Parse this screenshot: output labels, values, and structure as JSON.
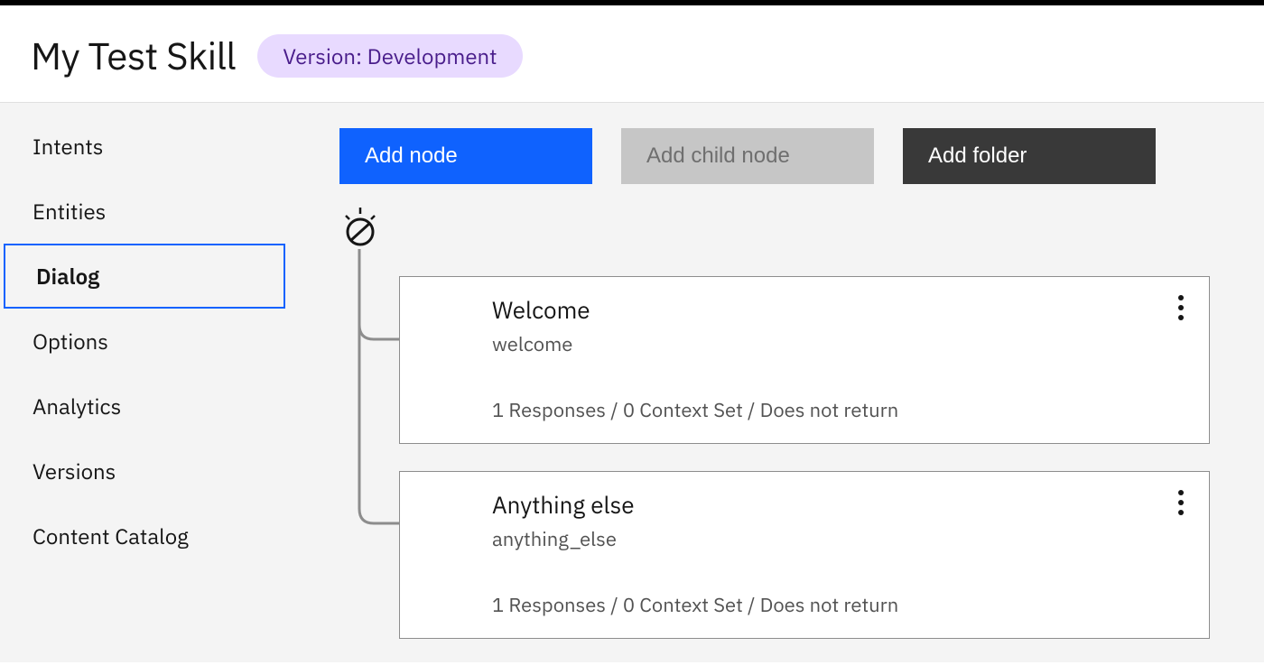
{
  "header": {
    "title": "My Test Skill",
    "version_label": "Version: Development"
  },
  "sidebar": {
    "items": [
      {
        "label": "Intents",
        "active": false
      },
      {
        "label": "Entities",
        "active": false
      },
      {
        "label": "Dialog",
        "active": true
      },
      {
        "label": "Options",
        "active": false
      },
      {
        "label": "Analytics",
        "active": false
      },
      {
        "label": "Versions",
        "active": false
      },
      {
        "label": "Content Catalog",
        "active": false
      }
    ]
  },
  "actions": {
    "add_node": "Add node",
    "add_child_node": "Add child node",
    "add_folder": "Add folder"
  },
  "dialog": {
    "nodes": [
      {
        "title": "Welcome",
        "condition": "welcome",
        "summary": "1 Responses / 0 Context Set / Does not return"
      },
      {
        "title": "Anything else",
        "condition": "anything_else",
        "summary": "1 Responses / 0 Context Set / Does not return"
      }
    ]
  }
}
